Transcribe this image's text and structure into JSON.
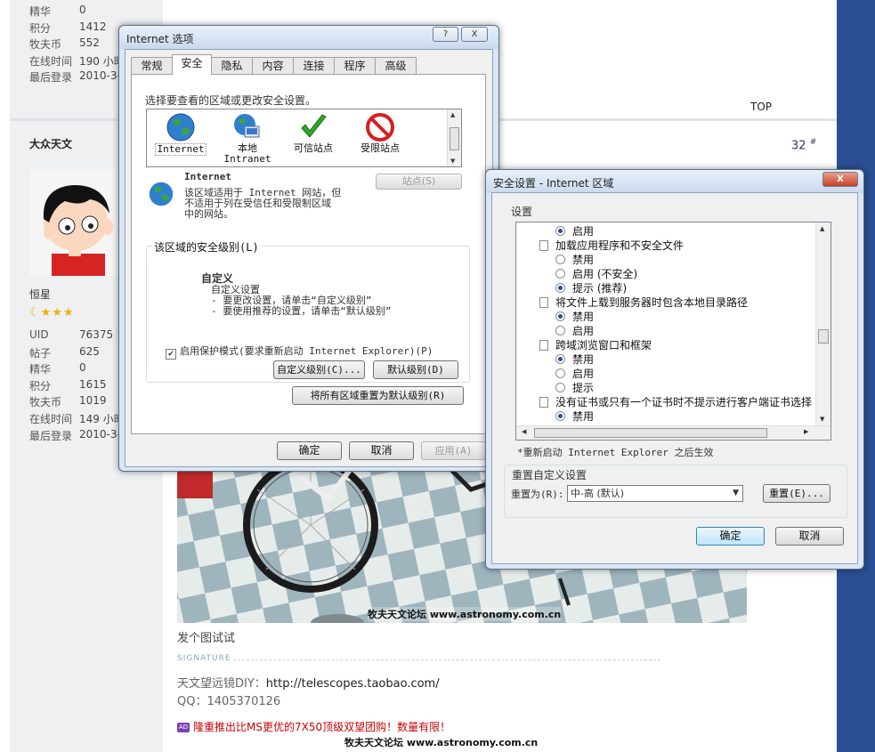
{
  "forum": {
    "user1_stats": [
      {
        "k": "精华",
        "v": "0"
      },
      {
        "k": "积分",
        "v": "1412"
      },
      {
        "k": "牧夫币",
        "v": "552"
      },
      {
        "k": "在线时间",
        "v": "190 小时"
      },
      {
        "k": "最后登录",
        "v": "2010-3-"
      }
    ],
    "top_link": "TOP",
    "user2_name": "大众天文",
    "floor_no": "32",
    "floor_mark": "#",
    "user2_rank": "恒星",
    "user2_stats": [
      {
        "k": "UID",
        "v": "76375"
      },
      {
        "k": "帖子",
        "v": "625"
      },
      {
        "k": "精华",
        "v": "0"
      },
      {
        "k": "积分",
        "v": "1615"
      },
      {
        "k": "牧夫币",
        "v": "1019"
      },
      {
        "k": "在线时间",
        "v": "149 小时"
      },
      {
        "k": "最后登录",
        "v": "2010-3-"
      }
    ],
    "photo_watermark": "牧夫天文论坛 www.astronomy.com.cn",
    "post_text": "发个图试试",
    "signature_label": "SIGNATURE",
    "sig_line1_prefix": "天文望远镜DIY：",
    "sig_line1_link": "http://telescopes.taobao.com/",
    "sig_line2": "QQ：1405370126",
    "ad_icon": "AD",
    "ad_text": "隆重推出比MS更优的7X50顶级双望团购！数量有限！",
    "footer_watermark": "牧夫天文论坛 www.astronomy.com.cn"
  },
  "inet_options": {
    "title": "Internet 选项",
    "help_btn": "?",
    "close_btn": "X",
    "tabs": [
      "常规",
      "安全",
      "隐私",
      "内容",
      "连接",
      "程序",
      "高级"
    ],
    "active_tab": "安全",
    "instruction": "选择要查看的区域或更改安全设置。",
    "zones": [
      {
        "label": "Internet",
        "label2": "",
        "icon": "globe-icon"
      },
      {
        "label": "本地",
        "label2": "Intranet",
        "icon": "intranet-icon"
      },
      {
        "label": "可信站点",
        "label2": "",
        "icon": "checkmark-icon"
      },
      {
        "label": "受限站点",
        "label2": "",
        "icon": "restricted-icon"
      }
    ],
    "zone_title": "Internet",
    "zone_desc1": "该区域适用于 Internet 网站，但",
    "zone_desc2": "不适用于列在受信任和受限制区域",
    "zone_desc3": "中的网站。",
    "sites_btn": "站点(S)",
    "level_group": "该区域的安全级别(L)",
    "custom_title": "自定义",
    "custom_l1": "自定义设置",
    "custom_l2": "- 要更改设置，请单击“自定义级别”",
    "custom_l3": "- 要使用推荐的设置，请单击“默认级别”",
    "protected_mode": "启用保护模式(要求重新启动 Internet Explorer)(P)",
    "custom_level_btn": "自定义级别(C)...",
    "default_level_btn": "默认级别(D)",
    "reset_all_btn": "将所有区域重置为默认级别(R)",
    "ok": "确定",
    "cancel": "取消",
    "apply": "应用(A)"
  },
  "sec_settings": {
    "title": "安全设置 - Internet 区域",
    "close_btn": "X",
    "settings_label": "设置",
    "rows": [
      {
        "type": "radio",
        "on": true,
        "text": "启用"
      },
      {
        "type": "head",
        "text": "加载应用程序和不安全文件"
      },
      {
        "type": "radio",
        "on": false,
        "text": "禁用"
      },
      {
        "type": "radio",
        "on": false,
        "text": "启用 (不安全)"
      },
      {
        "type": "radio",
        "on": true,
        "text": "提示 (推荐)"
      },
      {
        "type": "head",
        "text": "将文件上载到服务器时包含本地目录路径"
      },
      {
        "type": "radio",
        "on": true,
        "text": "禁用"
      },
      {
        "type": "radio",
        "on": false,
        "text": "启用"
      },
      {
        "type": "head",
        "text": "跨域浏览窗口和框架"
      },
      {
        "type": "radio",
        "on": true,
        "text": "禁用"
      },
      {
        "type": "radio",
        "on": false,
        "text": "启用"
      },
      {
        "type": "radio",
        "on": false,
        "text": "提示"
      },
      {
        "type": "head",
        "text": "没有证书或只有一个证书时不提示进行客户端证书选择"
      },
      {
        "type": "radio",
        "on": true,
        "text": "禁用"
      }
    ],
    "restart_note": "*重新启动 Internet Explorer 之后生效",
    "reset_group": "重置自定义设置",
    "reset_to": "重置为(R):",
    "reset_value": "中-高 (默认)",
    "reset_btn": "重置(E)...",
    "ok": "确定",
    "cancel": "取消"
  }
}
